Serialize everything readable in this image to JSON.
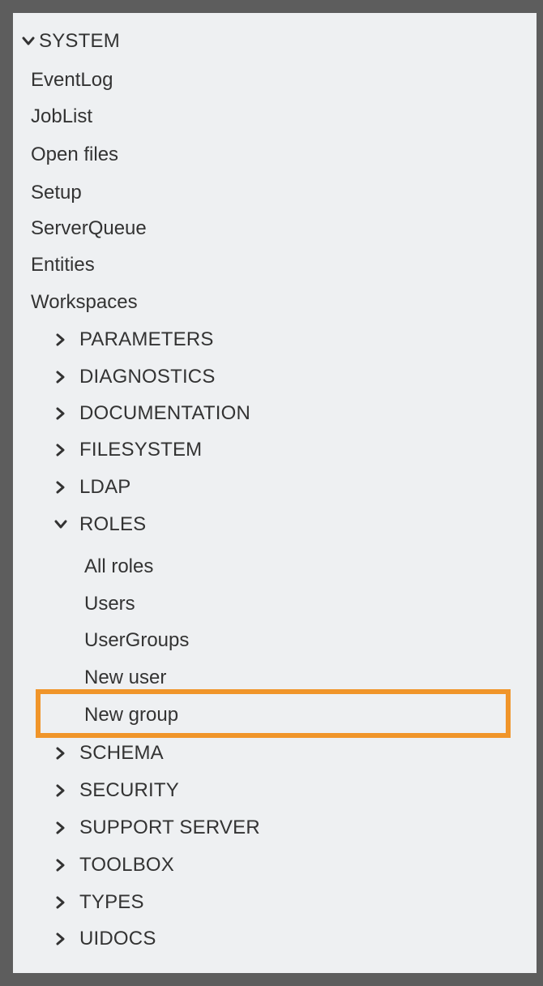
{
  "tree": {
    "root": {
      "label": "SYSTEM",
      "expanded": true,
      "icon": "chevron-down-icon"
    },
    "system_items": [
      "EventLog",
      "JobList",
      "Open files",
      "Setup",
      "ServerQueue",
      "Entities",
      "Workspaces"
    ],
    "folders_before": [
      {
        "label": "PARAMETERS",
        "icon": "chevron-right-icon"
      },
      {
        "label": "DIAGNOSTICS",
        "icon": "chevron-right-icon"
      },
      {
        "label": "DOCUMENTATION",
        "icon": "chevron-right-icon"
      },
      {
        "label": "FILESYSTEM",
        "icon": "chevron-right-icon"
      },
      {
        "label": "LDAP",
        "icon": "chevron-right-icon"
      }
    ],
    "roles": {
      "label": "ROLES",
      "expanded": true,
      "icon": "chevron-down-icon",
      "items": [
        "All roles",
        "Users",
        "UserGroups",
        "New user",
        "New group"
      ]
    },
    "folders_after": [
      {
        "label": "SCHEMA",
        "icon": "chevron-right-icon"
      },
      {
        "label": "SECURITY",
        "icon": "chevron-right-icon"
      },
      {
        "label": "SUPPORT SERVER",
        "icon": "chevron-right-icon"
      },
      {
        "label": "TOOLBOX",
        "icon": "chevron-right-icon"
      },
      {
        "label": "TYPES",
        "icon": "chevron-right-icon"
      },
      {
        "label": "UIDOCS",
        "icon": "chevron-right-icon"
      }
    ]
  },
  "highlight": {
    "target": "New group",
    "color": "#f0952a"
  },
  "colors": {
    "panel_background": "#eef0f2",
    "frame": "#5d5d5d",
    "text": "#333333"
  }
}
